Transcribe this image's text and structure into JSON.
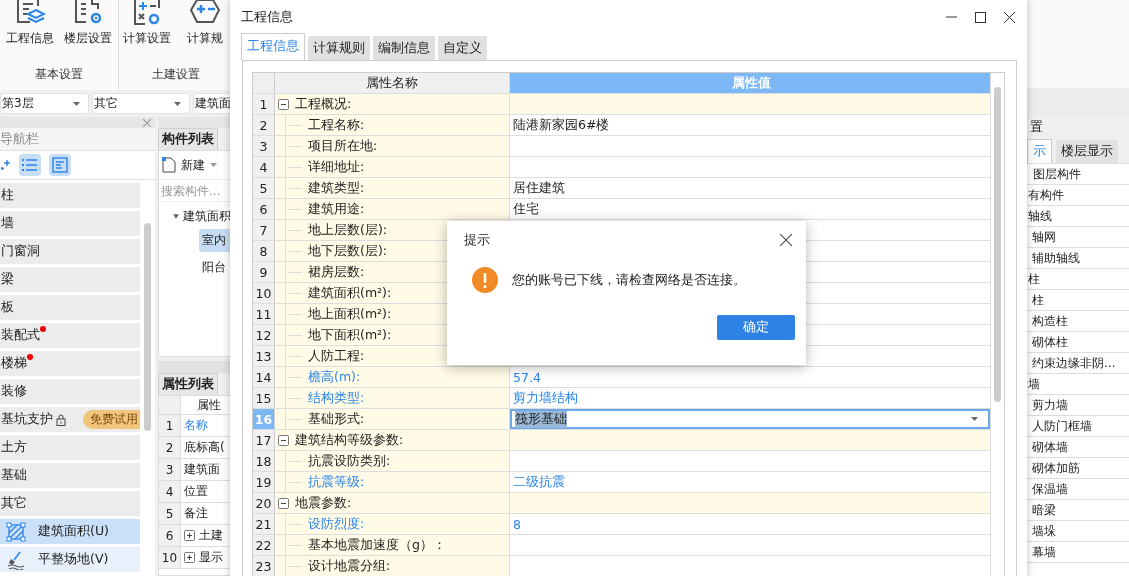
{
  "ribbon": {
    "groups": [
      {
        "label": "基本设置",
        "buttons": [
          {
            "label": "工程信息",
            "kind": "info"
          },
          {
            "label": "楼层设置",
            "kind": "floors"
          }
        ]
      },
      {
        "label": "土建设置",
        "buttons": [
          {
            "label": "计算设置",
            "kind": "calc"
          },
          {
            "label": "计算规",
            "kind": "rules"
          }
        ]
      }
    ]
  },
  "selectors": [
    {
      "value": "第3层",
      "arrow": true
    },
    {
      "value": "其它",
      "arrow": true
    },
    {
      "value": "建筑面",
      "arrow": false
    }
  ],
  "navigator": {
    "title": "导航栏",
    "items": [
      {
        "label": "柱",
        "new": false,
        "locked": false
      },
      {
        "label": "墙",
        "new": false,
        "locked": false
      },
      {
        "label": "门窗洞",
        "new": false,
        "locked": false
      },
      {
        "label": "梁",
        "new": false,
        "locked": false
      },
      {
        "label": "板",
        "new": false,
        "locked": false
      },
      {
        "label": "装配式",
        "new": true,
        "locked": false
      },
      {
        "label": "楼梯",
        "new": true,
        "locked": false
      },
      {
        "label": "装修",
        "new": false,
        "locked": false
      },
      {
        "label": "基坑支护",
        "new": false,
        "locked": true,
        "badge": "免费试用"
      },
      {
        "label": "土方",
        "new": false,
        "locked": false
      },
      {
        "label": "基础",
        "new": false,
        "locked": false
      },
      {
        "label": "其它",
        "new": false,
        "locked": false,
        "children": [
          {
            "label": "建筑面积(U)",
            "kind": "area",
            "selected": true
          },
          {
            "label": "平整场地(V)",
            "kind": "site",
            "selected": false
          }
        ]
      }
    ]
  },
  "component_list": {
    "tab": "构件列表",
    "new_button": "新建",
    "search_placeholder": "搜索构件...",
    "tree": [
      {
        "label": "建筑面积",
        "expanded": true,
        "children": [
          {
            "label": "室内",
            "selected": true
          },
          {
            "label": "阳台",
            "selected": false
          }
        ]
      }
    ]
  },
  "property_list": {
    "tab": "属性列表",
    "column": "属性",
    "rows": [
      {
        "num": "1",
        "name": "名称",
        "highlight": true,
        "expandable": false
      },
      {
        "num": "2",
        "name": "底标高(",
        "highlight": false,
        "expandable": false
      },
      {
        "num": "3",
        "name": "建筑面",
        "highlight": false,
        "expandable": false
      },
      {
        "num": "4",
        "name": "位置",
        "highlight": false,
        "expandable": false
      },
      {
        "num": "5",
        "name": "备注",
        "highlight": false,
        "expandable": false
      },
      {
        "num": "6",
        "name": "土建",
        "highlight": false,
        "expandable": true
      },
      {
        "num": "10",
        "name": "显示",
        "highlight": false,
        "expandable": true
      }
    ]
  },
  "layer_panel": {
    "title": "置",
    "tabs": [
      {
        "label": "示",
        "selected": true
      },
      {
        "label": "楼层显示",
        "selected": false
      }
    ],
    "column": "图层构件",
    "tree": [
      {
        "label": "有构件"
      },
      {
        "label": "轴线",
        "children": [
          {
            "label": "轴网"
          },
          {
            "label": "辅助轴线"
          }
        ]
      },
      {
        "label": "柱",
        "children": [
          {
            "label": "柱"
          },
          {
            "label": "构造柱"
          },
          {
            "label": "砌体柱"
          },
          {
            "label": "约束边缘非阴..."
          }
        ]
      },
      {
        "label": "墙",
        "children": [
          {
            "label": "剪力墙"
          },
          {
            "label": "人防门框墙"
          },
          {
            "label": "砌体墙"
          },
          {
            "label": "砌体加筋"
          },
          {
            "label": "保温墙"
          },
          {
            "label": "暗梁"
          },
          {
            "label": "墙垛"
          },
          {
            "label": "幕墙"
          }
        ]
      }
    ]
  },
  "project_dialog": {
    "title": "工程信息",
    "tabs": [
      {
        "label": "工程信息",
        "selected": true
      },
      {
        "label": "计算规则",
        "selected": false
      },
      {
        "label": "编制信息",
        "selected": false
      },
      {
        "label": "自定义",
        "selected": false
      }
    ],
    "columns": [
      "属性名称",
      "属性值"
    ],
    "rows": [
      {
        "num": "1",
        "name": "工程概况:",
        "expanded": true,
        "selected": false,
        "children": [
          {
            "num": "2",
            "name": "工程名称:",
            "value": "陆港新家园6#楼",
            "highlight": false,
            "selected": false
          },
          {
            "num": "3",
            "name": "项目所在地:",
            "highlight": false,
            "selected": false
          },
          {
            "num": "4",
            "name": "详细地址:",
            "highlight": false,
            "selected": false
          },
          {
            "num": "5",
            "name": "建筑类型:",
            "value": "居住建筑",
            "highlight": false,
            "selected": false
          },
          {
            "num": "6",
            "name": "建筑用途:",
            "value": "住宅",
            "highlight": false,
            "selected": false
          },
          {
            "num": "7",
            "name": "地上层数(层):",
            "highlight": false,
            "selected": false
          },
          {
            "num": "8",
            "name": "地下层数(层):",
            "highlight": false,
            "selected": false
          },
          {
            "num": "9",
            "name": "裙房层数:",
            "highlight": false,
            "selected": false
          },
          {
            "num": "10",
            "name": "建筑面积(m²):",
            "highlight": false,
            "selected": false
          },
          {
            "num": "11",
            "name": "地上面积(m²):",
            "highlight": false,
            "selected": false
          },
          {
            "num": "12",
            "name": "地下面积(m²):",
            "highlight": false,
            "selected": false
          },
          {
            "num": "13",
            "name": "人防工程:",
            "highlight": false,
            "selected": false
          },
          {
            "num": "14",
            "name": "檐高(m):",
            "value": "57.4",
            "highlight": true,
            "selected": false
          },
          {
            "num": "15",
            "name": "结构类型:",
            "value": "剪力墙结构",
            "highlight": true,
            "selected": false
          },
          {
            "num": "16",
            "name": "基础形式:",
            "value": "筏形基础",
            "highlight": false,
            "selected": true
          }
        ]
      },
      {
        "num": "17",
        "name": "建筑结构等级参数:",
        "expanded": true,
        "selected": false,
        "children": [
          {
            "num": "18",
            "name": "抗震设防类别:",
            "highlight": false,
            "selected": false
          },
          {
            "num": "19",
            "name": "抗震等级:",
            "value": "二级抗震",
            "highlight": true,
            "selected": false
          }
        ]
      },
      {
        "num": "20",
        "name": "地震参数:",
        "expanded": true,
        "selected": false,
        "children": [
          {
            "num": "21",
            "name": "设防烈度:",
            "value": "8",
            "highlight": true,
            "selected": false
          },
          {
            "num": "22",
            "name": "基本地震加速度（g）：",
            "highlight": false,
            "selected": false
          },
          {
            "num": "23",
            "name": "设计地震分组:",
            "highlight": false,
            "selected": false
          }
        ]
      }
    ]
  },
  "alert": {
    "title": "提示",
    "message": "您的账号已下线，请检查网络是否连接。",
    "button": "确定"
  }
}
